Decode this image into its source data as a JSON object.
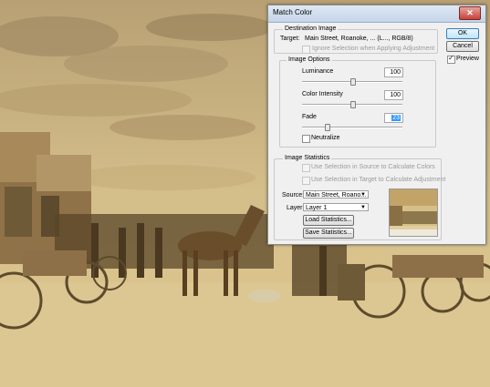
{
  "dialog": {
    "title": "Match Color",
    "close_label": "✕",
    "ok_label": "OK",
    "cancel_label": "Cancel",
    "preview_label": "Preview",
    "preview_checked": true
  },
  "destination": {
    "group_label": "Destination Image",
    "target_label": "Target:",
    "target_value": "Main Street, Roanoke, ... (L..., RGB/8)",
    "ignore_selection_label": "Ignore Selection when Applying Adjustment",
    "ignore_selection_checked": false
  },
  "image_options": {
    "group_label": "Image Options",
    "luminance_label": "Luminance",
    "luminance_value": "100",
    "color_intensity_label": "Color Intensity",
    "color_intensity_value": "100",
    "fade_label": "Fade",
    "fade_value": "23",
    "neutralize_label": "Neutralize",
    "neutralize_checked": false
  },
  "image_statistics": {
    "group_label": "Image Statistics",
    "use_source_label": "Use Selection in Source to Calculate Colors",
    "use_target_label": "Use Selection in Target to Calculate Adjustment",
    "source_label": "Source:",
    "source_value": "Main Street, Roano...",
    "layer_label": "Layer:",
    "layer_value": "Layer 1",
    "load_label": "Load Statistics...",
    "save_label": "Save Statistics..."
  },
  "colors": {
    "sepia_light": "#d7bf88",
    "sepia_mid": "#c2a468",
    "sepia_dark": "#6e5a36"
  }
}
